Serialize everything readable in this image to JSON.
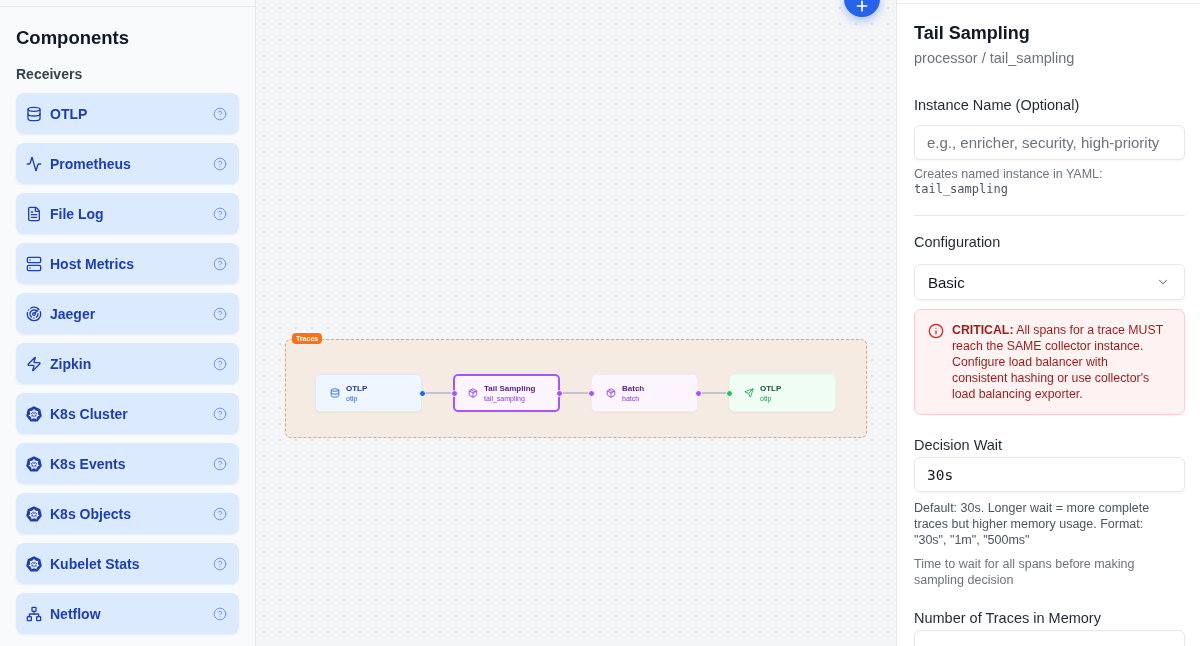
{
  "sidebar": {
    "title": "Components",
    "section": "Receivers",
    "items": [
      {
        "label": "OTLP"
      },
      {
        "label": "Prometheus"
      },
      {
        "label": "File Log"
      },
      {
        "label": "Host Metrics"
      },
      {
        "label": "Jaeger"
      },
      {
        "label": "Zipkin"
      },
      {
        "label": "K8s Cluster"
      },
      {
        "label": "K8s Events"
      },
      {
        "label": "K8s Objects"
      },
      {
        "label": "Kubelet Stats"
      },
      {
        "label": "Netflow"
      }
    ]
  },
  "canvas": {
    "group": {
      "label": "Traces"
    },
    "nodes": [
      {
        "kind": "receiver",
        "title": "OTLP",
        "subtitle": "otlp",
        "selected": false
      },
      {
        "kind": "processor",
        "title": "Tail Sampling",
        "subtitle": "tail_sampling",
        "selected": true
      },
      {
        "kind": "processor",
        "title": "Batch",
        "subtitle": "batch",
        "selected": false
      },
      {
        "kind": "exporter",
        "title": "OTLP",
        "subtitle": "otlp",
        "selected": false
      }
    ]
  },
  "panel": {
    "title": "Tail Sampling",
    "subtitle": "processor / tail_sampling",
    "instance_name": {
      "label": "Instance Name (Optional)",
      "placeholder": "e.g., enricher, security, high-priority",
      "helper": "Creates named instance in YAML:",
      "yaml_name": "tail_sampling"
    },
    "configuration": {
      "label": "Configuration",
      "value": "Basic"
    },
    "alert": {
      "text": "**CRITICAL:** All spans for a trace MUST reach the SAME collector instance. Configure load balancer with consistent hashing or use collector's load balancing exporter."
    },
    "fields": [
      {
        "label": "Decision Wait",
        "value": "30s",
        "help": "Default: 30s. Longer wait = more complete traces but higher memory usage. Format: \"30s\", \"1m\", \"500ms\"",
        "description": "Time to wait for all spans before making sampling decision"
      },
      {
        "label": "Number of Traces in Memory"
      }
    ]
  }
}
